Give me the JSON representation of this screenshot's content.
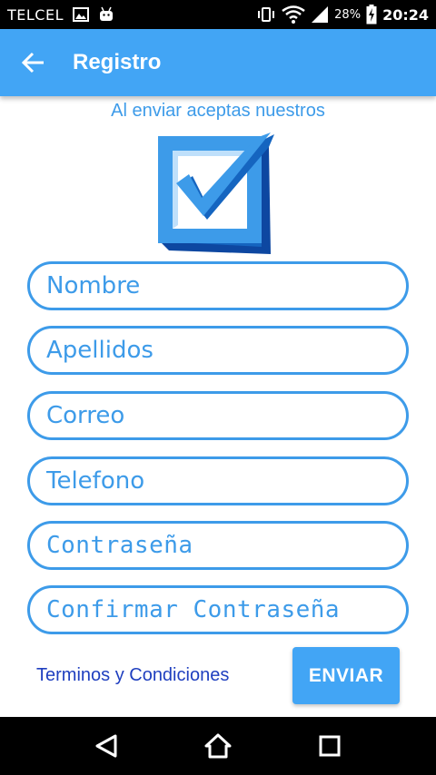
{
  "status_bar": {
    "carrier": "TELCEL",
    "battery_percent": "28%",
    "time": "20:24",
    "icons": [
      "image-icon",
      "android-icon",
      "vibrate-icon",
      "wifi-icon",
      "signal-icon",
      "battery-charging-icon"
    ]
  },
  "app_bar": {
    "title": "Registro",
    "back_icon": "arrow-back-icon",
    "color": "#42a5f5"
  },
  "content": {
    "subtitle": "Al enviar aceptas nuestros",
    "logo_icon": "checkbox-check-icon"
  },
  "form": {
    "nombre_placeholder": "Nombre",
    "apellidos_placeholder": "Apellidos",
    "correo_placeholder": "Correo",
    "telefono_placeholder": "Telefono",
    "password_placeholder": "Contraseña",
    "confirm_password_placeholder": "Confirmar Contraseña",
    "accent_color": "#3d9be9"
  },
  "footer": {
    "terms_link": "Terminos y Condiciones",
    "send_button": "ENVIAR"
  },
  "nav_bar": {
    "icons": [
      "back-triangle-icon",
      "home-icon",
      "recents-square-icon"
    ]
  }
}
